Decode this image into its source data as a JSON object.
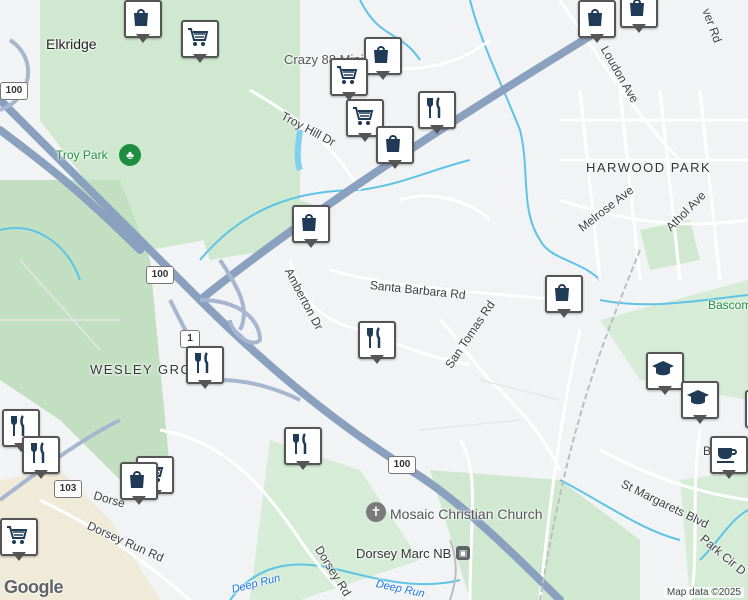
{
  "places": {
    "elkridge": "Elkridge",
    "troy_park": "Troy Park",
    "harwood_park": "HARWOOD PARK",
    "wesley_grove": "WESLEY GROVE",
    "crazy_market": "Crazy 88 Mini Market",
    "mosaic_church": "Mosaic Christian Church",
    "dorsey_marc": "Dorsey Marc NB",
    "bascom": "Bascom"
  },
  "roads": {
    "troy_hill": "Troy Hill Dr",
    "santa_barbara": "Santa Barbara Rd",
    "amberton": "Amberton Dr",
    "san_tomas": "San Tomas Rd",
    "loudon": "Loudon Ave",
    "melrose": "Melrose Ave",
    "athol": "Athol Ave",
    "dorsey_run": "Dorsey Run Rd",
    "dorsey_rd": "Dorsey Rd",
    "dorsey_partial": "Dorse",
    "st_margarets": "St Margarets Blvd",
    "park_cir": "Park Cir D",
    "dover": "ver Rd",
    "b_partial": "B"
  },
  "water": {
    "deep_run_1": "Deep Run",
    "deep_run_2": "Deep Run"
  },
  "shields": {
    "r100a": "100",
    "r100b": "100",
    "r100c": "100",
    "r1": "1",
    "r103": "103"
  },
  "icons": {
    "shop": "shopping-bag-icon",
    "grocery": "shopping-cart-icon",
    "food": "restaurant-icon",
    "school": "school-icon",
    "cafe": "cafe-icon",
    "church": "church-icon",
    "park": "park-icon",
    "train": "train-icon"
  },
  "colors": {
    "highway": "#8aa0bf",
    "park": "#cfe8cf",
    "water": "#5ec4e6",
    "pin_border": "#555555"
  },
  "footer": {
    "logo": "Google",
    "attribution": "Map data ©2025"
  }
}
